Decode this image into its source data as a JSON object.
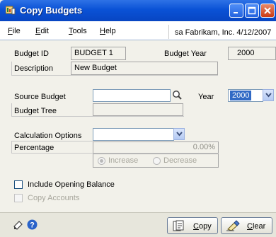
{
  "window": {
    "title": "Copy Budgets"
  },
  "menu": {
    "items": [
      {
        "label": "File",
        "key": "F",
        "rest": "ile"
      },
      {
        "label": "Edit",
        "key": "E",
        "rest": "dit"
      },
      {
        "label": "Tools",
        "key": "T",
        "rest": "ools"
      },
      {
        "label": "Help",
        "key": "H",
        "rest": "elp"
      }
    ],
    "status": "sa  Fabrikam, Inc.  4/12/2007"
  },
  "form": {
    "budget_id_label": "Budget ID",
    "budget_id_value": "BUDGET 1",
    "budget_year_label": "Budget Year",
    "budget_year_value": "2000",
    "description_label": "Description",
    "description_value": "New Budget",
    "source_budget_label": "Source Budget",
    "source_budget_value": "",
    "year_label": "Year",
    "year_value": "2000",
    "budget_tree_label": "Budget Tree",
    "calc_options_label": "Calculation Options",
    "calc_options_value": "",
    "percentage_label": "Percentage",
    "percentage_value": "0.00%",
    "increase_label": "Increase",
    "decrease_label": "Decrease",
    "include_opening_label": "Include Opening Balance",
    "copy_accounts_label": "Copy Accounts"
  },
  "buttons": {
    "copy": {
      "key": "C",
      "rest": "opy",
      "label": "Copy"
    },
    "clear": {
      "key": "C",
      "rest": "lear",
      "label": "Clear"
    }
  },
  "colors": {
    "titlebar": "#0a52d6",
    "window_bg": "#f2f1ea",
    "year_highlight": "#316ac5"
  },
  "icons": [
    "budget-window-icon",
    "minimize-icon",
    "maximize-icon",
    "close-icon",
    "lookup-icon",
    "chevron-down-icon",
    "note-icon",
    "help-icon",
    "copy-icon",
    "clear-icon"
  ]
}
